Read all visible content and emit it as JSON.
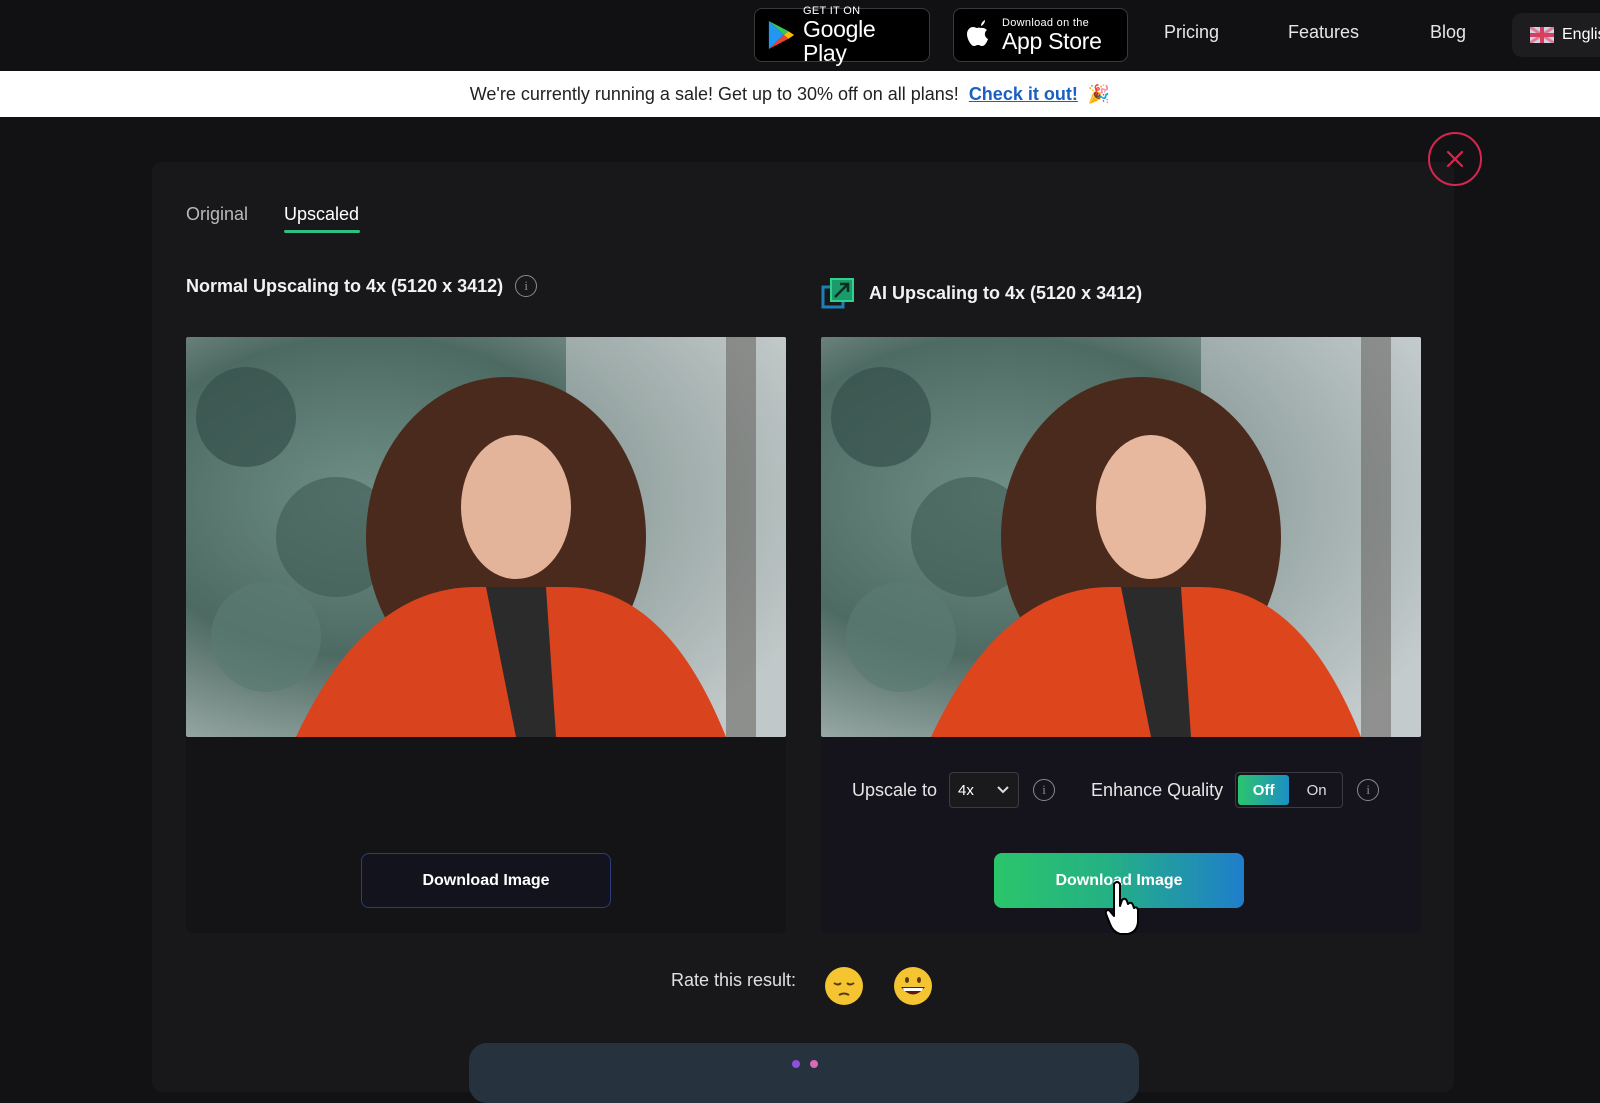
{
  "nav": {
    "google_play": {
      "small": "GET IT ON",
      "big": "Google Play"
    },
    "app_store": {
      "small": "Download on the",
      "big": "App Store"
    },
    "links": [
      "Pricing",
      "Features",
      "Blog"
    ],
    "language": "English"
  },
  "banner": {
    "text": "We're currently running a sale! Get up to 30% off on all plans!",
    "link": "Check it out!",
    "emoji": "🎉"
  },
  "tabs": [
    {
      "label": "Original",
      "active": false
    },
    {
      "label": "Upscaled",
      "active": true
    }
  ],
  "left_panel": {
    "title": "Normal Upscaling to 4x (5120 x 3412)",
    "download_label": "Download Image"
  },
  "right_panel": {
    "title": "AI Upscaling to 4x (5120 x 3412)",
    "upscale_label": "Upscale to",
    "upscale_value": "4x",
    "enhance_label": "Enhance Quality",
    "toggle_off": "Off",
    "toggle_on": "On",
    "toggle_state": "Off",
    "download_label": "Download Image"
  },
  "rating": {
    "label": "Rate this result:",
    "options": [
      "😔",
      "😀"
    ]
  },
  "icons": {
    "close": "close-icon",
    "info": "i"
  },
  "colors": {
    "accent_green": "#2fbf7e",
    "close_red": "#d7264f",
    "link_blue": "#1a5fc2"
  }
}
